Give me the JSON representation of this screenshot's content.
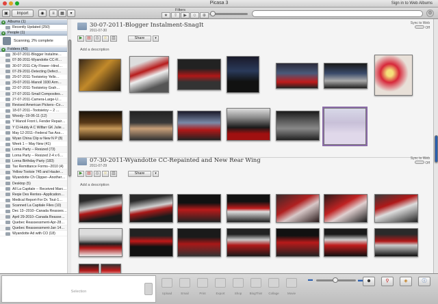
{
  "window": {
    "title": "Picasa 3",
    "sign_in": "Sign in to Web Albums",
    "colors": {
      "close": "#e0443e",
      "minimize": "#dea123",
      "zoom": "#1aab29"
    }
  },
  "toolbar": {
    "import_label": "Import",
    "filters_label": "Filters",
    "filter_icons": [
      "star-icon",
      "upload-icon",
      "video-icon",
      "person-icon",
      "geotag-icon"
    ],
    "search_value": ""
  },
  "sidebar": {
    "albums_header": "Albums (1)",
    "albums": [
      "Recently Updated (250)"
    ],
    "people_header": "People (1)",
    "people_status": "Scanning, 2% complete",
    "folders_header": "Folders (43)",
    "folders": [
      "30-07-2011-Blogger Instalme…",
      "07-30-2011-Wyandotte CC-R…",
      "30-07-2011-City Flower--Hind…",
      "07-29-2011-Detecting Defect…",
      "29-07-2011-Tootsietoy Yello…",
      "29-07-2011-Manoil 1930 Arm…",
      "22-07-2011-Tootsietoy Grah…",
      "27-07-2011-Small Composites…",
      "27-07-2011-Camera-Large-U…",
      "Revised American Pickers--Co…",
      "18-07-2011--Tootsietoy -- 2 …",
      "Woody--19-06-11 (12)",
      "Y Manoil Front L Fender Repair…",
      "Y Cl-Hubly A C Wilfarr GK Julie…",
      "May 12-2011--Federal Tax Ass…",
      "Wyan China Clip w New N P (8)",
      "Week 1 -- May New (41)",
      "Lorna Party -- Resized (73)",
      "Lorna Party -- Resized 2-4 x 6…",
      "Lorna Birthday Party (183)",
      "Tax Remittance Forms--2010 (4)",
      "Yellow Tootsie 745 and Hauler…",
      "Wyandotte Ch Clipper--Another…",
      "Desktop (5)",
      "All La Capitale -- Received Marc…",
      "Reqie Des Rentes--Application…",
      "Medical Report-For Dr. Tout-1…",
      "Scanned La Capitale Files (10)",
      "Dec 13--2010--Canada Reasses…",
      "April 29-2010--Canada Reasse…",
      "Quebec Reassessment-Apr-28…",
      "Quebec Reassessment-Jan 14…",
      "Wyandotte Ad with CO (18)"
    ]
  },
  "albums": [
    {
      "title": "30-07-2011-Blogger Instalment-SnagIt",
      "date": "2011-07-30",
      "sync": "Sync to Web",
      "sync_state": "Off",
      "share_label": "Share",
      "description_placeholder": "Add a description"
    },
    {
      "title": "07-30-2011-Wyandotte CC-Repainted and New Rear Wing",
      "date": "2011-07-29",
      "sync": "Sync to Web",
      "sync_state": "Off",
      "share_label": "Share",
      "description_placeholder": "Add a description"
    }
  ],
  "bottom": {
    "selection_label": "Selection",
    "actions": [
      "Upload",
      "Email",
      "Print",
      "Export",
      "Shop",
      "BlogThis!",
      "Collage",
      "Movie"
    ]
  }
}
